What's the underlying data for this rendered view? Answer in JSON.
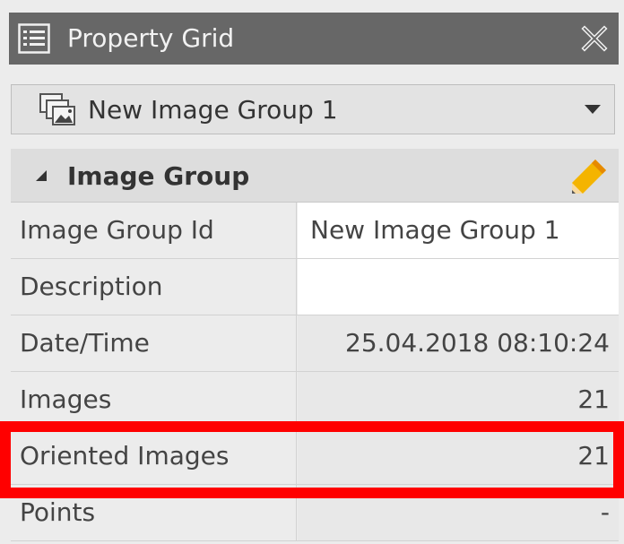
{
  "header": {
    "title": "Property Grid",
    "title_icon": "property-grid-icon",
    "close_icon": "close-pin-icon"
  },
  "selector": {
    "value": "New Image Group 1",
    "icon": "image-group-icon"
  },
  "category": {
    "title": "Image Group",
    "collapse_icon": "triangle-collapse-icon",
    "edit_icon": "pencil-icon"
  },
  "rows": [
    {
      "name": "Image Group Id",
      "value": "New Image Group 1"
    },
    {
      "name": "Description",
      "value": ""
    },
    {
      "name": "Date/Time",
      "value": "25.04.2018 08:10:24"
    },
    {
      "name": "Images",
      "value": "21"
    },
    {
      "name": "Oriented Images",
      "value": "21"
    },
    {
      "name": "Points",
      "value": "-"
    }
  ],
  "colors": {
    "titlebar": "#676767",
    "highlight": "#ff0000",
    "pencil": "#f4b400"
  }
}
